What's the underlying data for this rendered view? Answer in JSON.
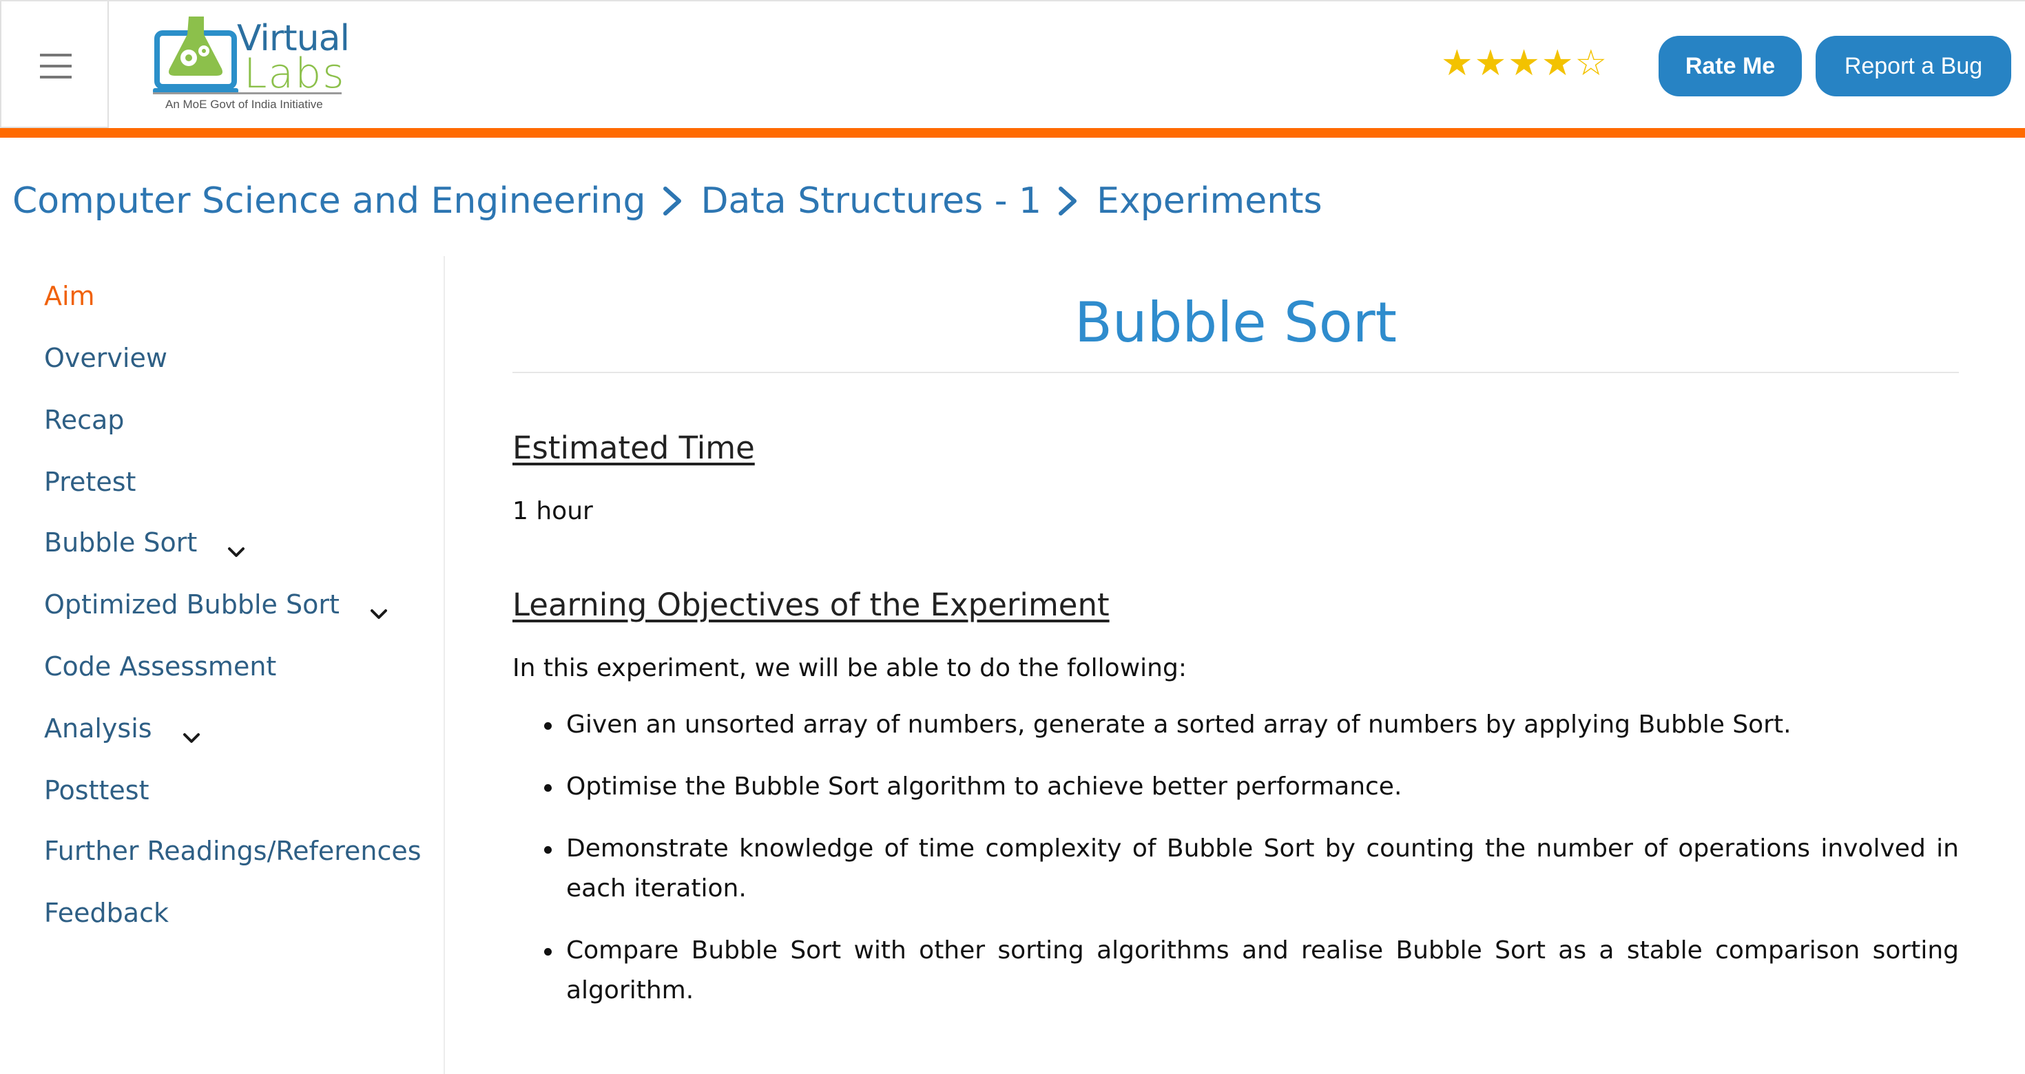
{
  "header": {
    "logo": {
      "word_top": "Virtual",
      "word_bottom": "Labs",
      "tagline": "An MoE Govt of India Initiative"
    },
    "rating": {
      "value": 4,
      "max": 5
    },
    "rate_label": "Rate Me",
    "bug_label": "Report a Bug",
    "accent": "#ff6a00",
    "button_color": "#2783c4"
  },
  "breadcrumb": {
    "items": [
      "Computer Science and Engineering",
      "Data Structures - 1",
      "Experiments"
    ]
  },
  "sidebar": {
    "items": [
      {
        "label": "Aim",
        "active": true,
        "expandable": false
      },
      {
        "label": "Overview",
        "active": false,
        "expandable": false
      },
      {
        "label": "Recap",
        "active": false,
        "expandable": false
      },
      {
        "label": "Pretest",
        "active": false,
        "expandable": false
      },
      {
        "label": "Bubble Sort",
        "active": false,
        "expandable": true
      },
      {
        "label": "Optimized Bubble Sort",
        "active": false,
        "expandable": true
      },
      {
        "label": "Code Assessment",
        "active": false,
        "expandable": false
      },
      {
        "label": "Analysis",
        "active": false,
        "expandable": true
      },
      {
        "label": "Posttest",
        "active": false,
        "expandable": false
      },
      {
        "label": "Further Readings/References",
        "active": false,
        "expandable": false
      },
      {
        "label": "Feedback",
        "active": false,
        "expandable": false
      }
    ]
  },
  "main": {
    "title": "Bubble Sort",
    "estimated_time_heading": "Estimated Time",
    "estimated_time": "1 hour",
    "objectives_heading": "Learning Objectives of the Experiment",
    "objectives_intro": "In this experiment, we will be able to do the following:",
    "objectives": [
      "Given an unsorted array of numbers, generate a sorted array of numbers by applying Bubble Sort.",
      "Optimise the Bubble Sort algorithm to achieve better performance.",
      "Demonstrate knowledge of time complexity of Bubble Sort by counting the number of operations involved in each iteration.",
      "Compare Bubble Sort with other sorting algorithms and realise Bubble Sort as a stable comparison sorting algorithm."
    ]
  }
}
